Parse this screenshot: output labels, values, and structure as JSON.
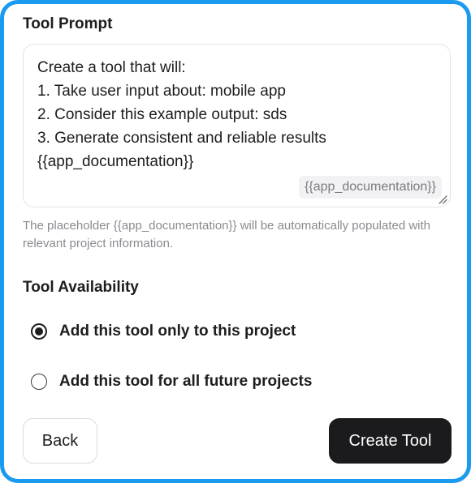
{
  "tool_prompt": {
    "title": "Tool Prompt",
    "text": "Create a tool that will:\n1. Take user input about: mobile app\n2. Consider this example output: sds\n3. Generate consistent and reliable results\n{{app_documentation}}",
    "placeholder_chip": "{{app_documentation}}",
    "helper_text": "The placeholder {{app_documentation}} will be automatically populated with relevant project information."
  },
  "availability": {
    "title": "Tool Availability",
    "options": [
      {
        "label": "Add this tool only to this project",
        "selected": true
      },
      {
        "label": "Add this tool for all future projects",
        "selected": false
      }
    ]
  },
  "buttons": {
    "back": "Back",
    "create": "Create Tool"
  },
  "colors": {
    "frame_border": "#1a9bf0",
    "primary_button": "#1b1b1d",
    "helper_text": "#8a8a90"
  },
  "icons": {
    "resize": "resize-handle-icon",
    "radio_selected": "radio-checked-icon",
    "radio_unselected": "radio-unchecked-icon"
  }
}
